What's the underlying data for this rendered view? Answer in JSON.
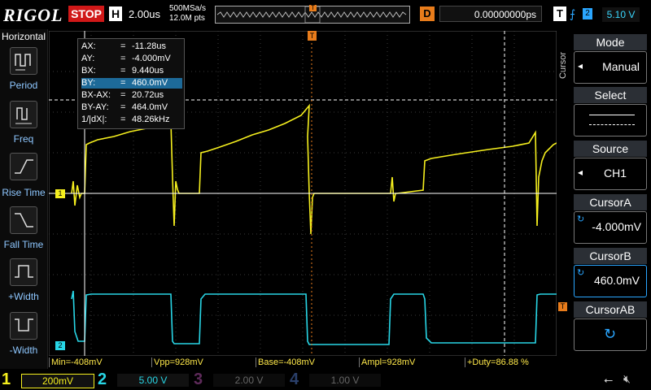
{
  "header": {
    "brand": "RIGOL",
    "run_state": "STOP",
    "horizontal_badge": "H",
    "timebase": "2.00us",
    "sample_rate": "500MSa/s",
    "mem_depth": "12.0M pts",
    "delay_badge": "D",
    "delay_value": "0.00000000ps",
    "trigger_badge": "T",
    "trigger_edge_icon": "rising-edge-icon",
    "trigger_channel": "2",
    "trigger_level": "5.10 V"
  },
  "left_panel": {
    "title": "Horizontal",
    "items": [
      {
        "label": "Period",
        "icon": "period-icon"
      },
      {
        "label": "Freq",
        "icon": "freq-icon"
      },
      {
        "label": "Rise Time",
        "icon": "rise-time-icon"
      },
      {
        "label": "Fall Time",
        "icon": "fall-time-icon"
      },
      {
        "label": "+Width",
        "icon": "pos-width-icon"
      },
      {
        "label": "-Width",
        "icon": "neg-width-icon"
      }
    ]
  },
  "cursor_readout": {
    "rows": [
      {
        "key": "AX:",
        "value": "-11.28us"
      },
      {
        "key": "AY:",
        "value": "-4.000mV"
      },
      {
        "key": "BX:",
        "value": "9.440us"
      },
      {
        "key": "BY:",
        "value": "460.0mV"
      },
      {
        "key": "BX-AX:",
        "value": "20.72us"
      },
      {
        "key": "BY-AY:",
        "value": "464.0mV"
      },
      {
        "key": "1/|dX|:",
        "value": "48.26kHz"
      }
    ],
    "eq": "="
  },
  "markers": {
    "trigger_position": "T",
    "ch1_ground": "1",
    "ch2_ground": "2",
    "trigger_level_marker": "T"
  },
  "right_menu": {
    "title": "Cursor",
    "items": [
      {
        "header": "Mode",
        "value": "Manual"
      },
      {
        "header": "Select",
        "value": ""
      },
      {
        "header": "Source",
        "value": "CH1"
      },
      {
        "header": "CursorA",
        "value": "-4.000mV"
      },
      {
        "header": "CursorB",
        "value": "460.0mV"
      },
      {
        "header": "CursorAB",
        "value": ""
      }
    ]
  },
  "measurements": [
    {
      "text": "Min=-408mV"
    },
    {
      "text": "Vpp=928mV"
    },
    {
      "text": "Base=-408mV"
    },
    {
      "text": "Ampl=928mV"
    },
    {
      "text": "+Duty=86.88 %"
    }
  ],
  "channels": [
    {
      "num": "1",
      "scale": "200mV",
      "color": "#f5ef1e",
      "active": true
    },
    {
      "num": "2",
      "scale": "5.00 V",
      "color": "#28d6e6",
      "active": true
    },
    {
      "num": "3",
      "scale": "2.00 V",
      "color": "#d04cc8",
      "active": false
    },
    {
      "num": "4",
      "scale": "1.00 V",
      "color": "#3a6fd8",
      "active": false
    }
  ],
  "status_icons": [
    "usb-icon",
    "speaker-muted-icon"
  ],
  "colors": {
    "ch1": "#f5ef1e",
    "ch2": "#28d6e6",
    "stop": "#d01818",
    "accent": "#2aa6ff",
    "delay": "#e87c1b"
  }
}
